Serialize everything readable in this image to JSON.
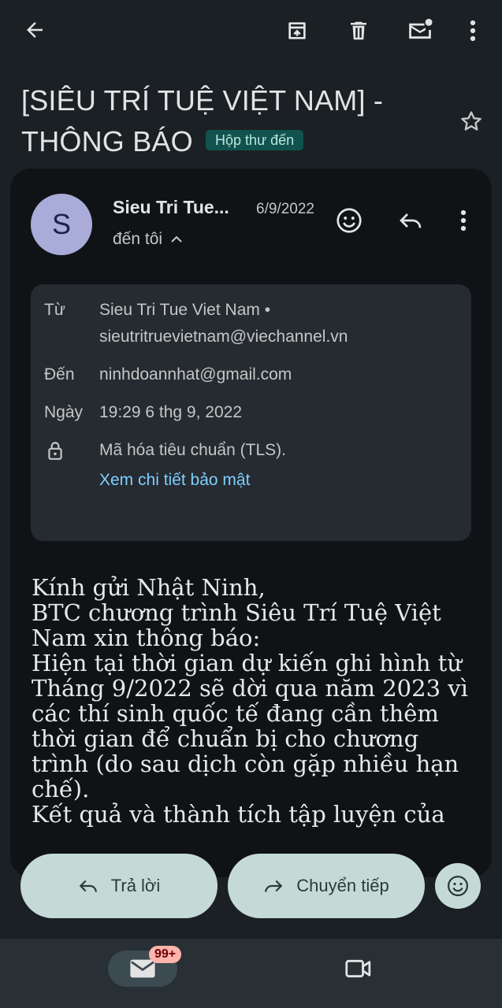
{
  "email": {
    "subject": "[SIÊU TRÍ TUỆ VIỆT NAM] - THÔNG BÁO",
    "label": "Hộp thư đến",
    "sender_initial": "S",
    "sender_short": "Sieu Tri Tue...",
    "date_short": "6/9/2022",
    "to_me": "đến tôi"
  },
  "details": {
    "from_label": "Từ",
    "from_name": "Sieu Tri Tue Viet Nam •",
    "from_email": "sieutritruevietnam@viechannel.vn",
    "to_label": "Đến",
    "to_email": "ninhdoannhat@gmail.com",
    "date_label": "Ngày",
    "date_value": "19:29 6 thg 9, 2022",
    "encryption": "Mã hóa tiêu chuẩn (TLS).",
    "security_link": "Xem chi tiết bảo mật"
  },
  "body": {
    "lines": [
      "Kính gửi Nhật Ninh,",
      "BTC chương trình Siêu Trí Tuệ Việt Nam xin thông báo:",
      "Hiện tại thời gian dự kiến ghi hình từ Tháng 9/2022 sẽ dời qua năm 2023 vì các thí sinh quốc tế đang cần thêm thời gian để chuẩn bị cho chương trình (do sau dịch còn gặp nhiều hạn chế).",
      "Kết quả và thành tích tập luyện của"
    ]
  },
  "actions": {
    "reply_label": "Trả lời",
    "forward_label": "Chuyển tiếp"
  },
  "nav": {
    "unread_count": "99+"
  },
  "colors": {
    "background": "#1b2025",
    "card": "#0f1316",
    "details_box": "#252b30",
    "action_pill": "#c5dad6",
    "link": "#7fcfff",
    "label_badge": "#11524e",
    "unread_badge": "#ffb4ab"
  }
}
